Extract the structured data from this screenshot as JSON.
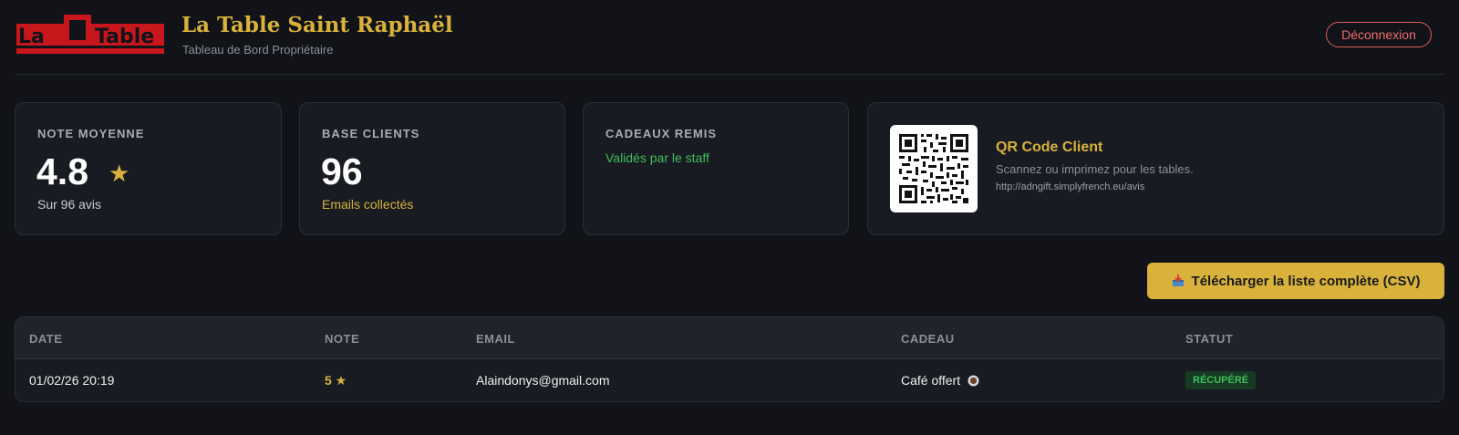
{
  "header": {
    "logo_text": "La Table",
    "title": "La Table Saint Raphaël",
    "subtitle": "Tableau de Bord Propriétaire",
    "logout_label": "Déconnexion"
  },
  "stats": {
    "rating": {
      "label": "NOTE MOYENNE",
      "value": "4.8",
      "star": "★",
      "sub": "Sur 96 avis"
    },
    "clients": {
      "label": "BASE CLIENTS",
      "value": "96",
      "sub": "Emails collectés"
    },
    "gifts": {
      "label": "CADEAUX REMIS",
      "sub": "Validés par le staff"
    },
    "qr": {
      "title": "QR Code Client",
      "description": "Scannez ou imprimez pour les tables.",
      "url": "http://adngift.simplyfrench.eu/avis"
    }
  },
  "actions": {
    "csv_label": "Télécharger la liste complète (CSV)"
  },
  "table": {
    "columns": [
      "DATE",
      "NOTE",
      "EMAIL",
      "CADEAU",
      "STATUT"
    ],
    "rows": [
      {
        "date": "01/02/26 20:19",
        "note": "5 ★",
        "email": "Alaindonys@gmail.com",
        "gift": "Café offert",
        "status": "RÉCUPÉRÉ"
      }
    ]
  },
  "colors": {
    "background": "#111318",
    "card": "#181b22",
    "gold": "#d9b23c",
    "green": "#3fbf5a",
    "red": "#e05a5a",
    "logo_red": "#c8161d"
  },
  "icons": {
    "csv": "inbox-tray-icon",
    "gift": "coffee-cup-icon",
    "rating": "star-icon"
  }
}
